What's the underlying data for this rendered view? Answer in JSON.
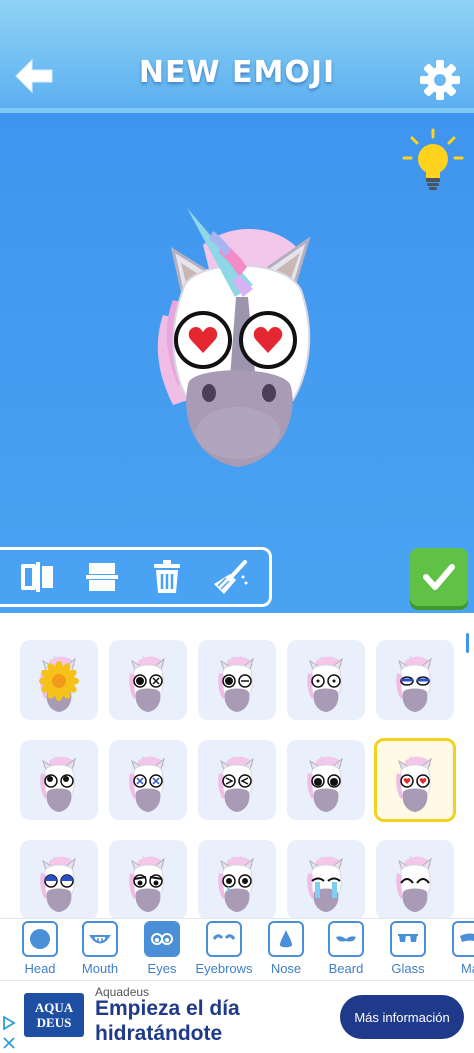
{
  "header": {
    "title": "NEW EMOJI"
  },
  "tabs": [
    {
      "label": "Head",
      "icon": "head-icon"
    },
    {
      "label": "Mouth",
      "icon": "mouth-icon"
    },
    {
      "label": "Eyes",
      "icon": "eyes-icon",
      "active": true
    },
    {
      "label": "Eyebrows",
      "icon": "eyebrows-icon"
    },
    {
      "label": "Nose",
      "icon": "nose-icon"
    },
    {
      "label": "Beard",
      "icon": "beard-icon"
    },
    {
      "label": "Glass",
      "icon": "glass-icon"
    },
    {
      "label": "Ma",
      "icon": "mask-icon"
    }
  ],
  "options": {
    "selected_index": 9,
    "eye_styles": [
      "sunflower",
      "dot-x",
      "dot-x-closed",
      "wide",
      "sleepy-blue",
      "rolling",
      "dizzy-x",
      "squint",
      "round-black",
      "hearts",
      "blue-half",
      "grumpy",
      "teary",
      "crying",
      "laughing"
    ]
  },
  "ad": {
    "logo_line1": "AQUA",
    "logo_line2": "DEUS",
    "brand": "Aquadeus",
    "headline": "Empieza el día hidratándote",
    "cta": "Más información"
  },
  "colors": {
    "canvas": "#3f95ee",
    "accent": "#4a8fd8",
    "confirm": "#5fc247",
    "selected": "#f3d21c"
  }
}
